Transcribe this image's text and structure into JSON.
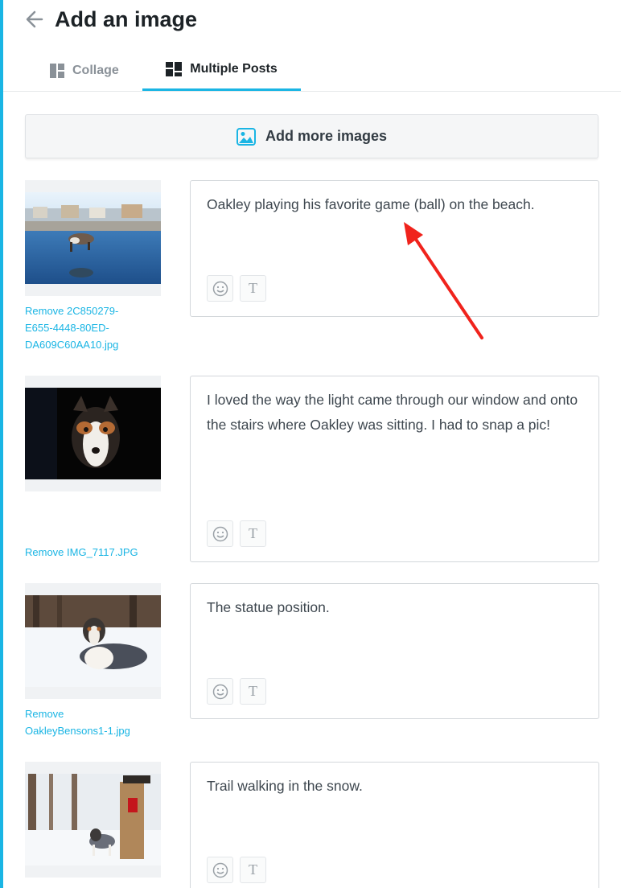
{
  "header": {
    "title": "Add an image"
  },
  "tabs": [
    {
      "label": "Collage"
    },
    {
      "label": "Multiple Posts"
    }
  ],
  "add_more": {
    "label": "Add more images"
  },
  "posts": [
    {
      "remove_label": "Remove 2C850279-E655-4448-80ED-DA609C60AA10.jpg",
      "caption": "Oakley playing his favorite game (ball) on the beach."
    },
    {
      "remove_label": "Remove IMG_7117.JPG",
      "caption": "I loved the way the light came through our window and onto the stairs where Oakley was sitting. I had to snap a pic!"
    },
    {
      "remove_label": "Remove OakleyBensons1-1.jpg",
      "caption": "The statue position."
    },
    {
      "remove_label": "",
      "caption": "Trail walking in the snow."
    }
  ],
  "colors": {
    "accent": "#1ab5e4",
    "annotation_arrow": "#f0231c"
  },
  "icons": {
    "back": "arrow-left-icon",
    "collage": "collage-icon",
    "multiple_posts": "multiple-posts-icon",
    "add_image": "image-icon",
    "emoji": "smiley-icon",
    "text_format": "text-format-icon"
  }
}
